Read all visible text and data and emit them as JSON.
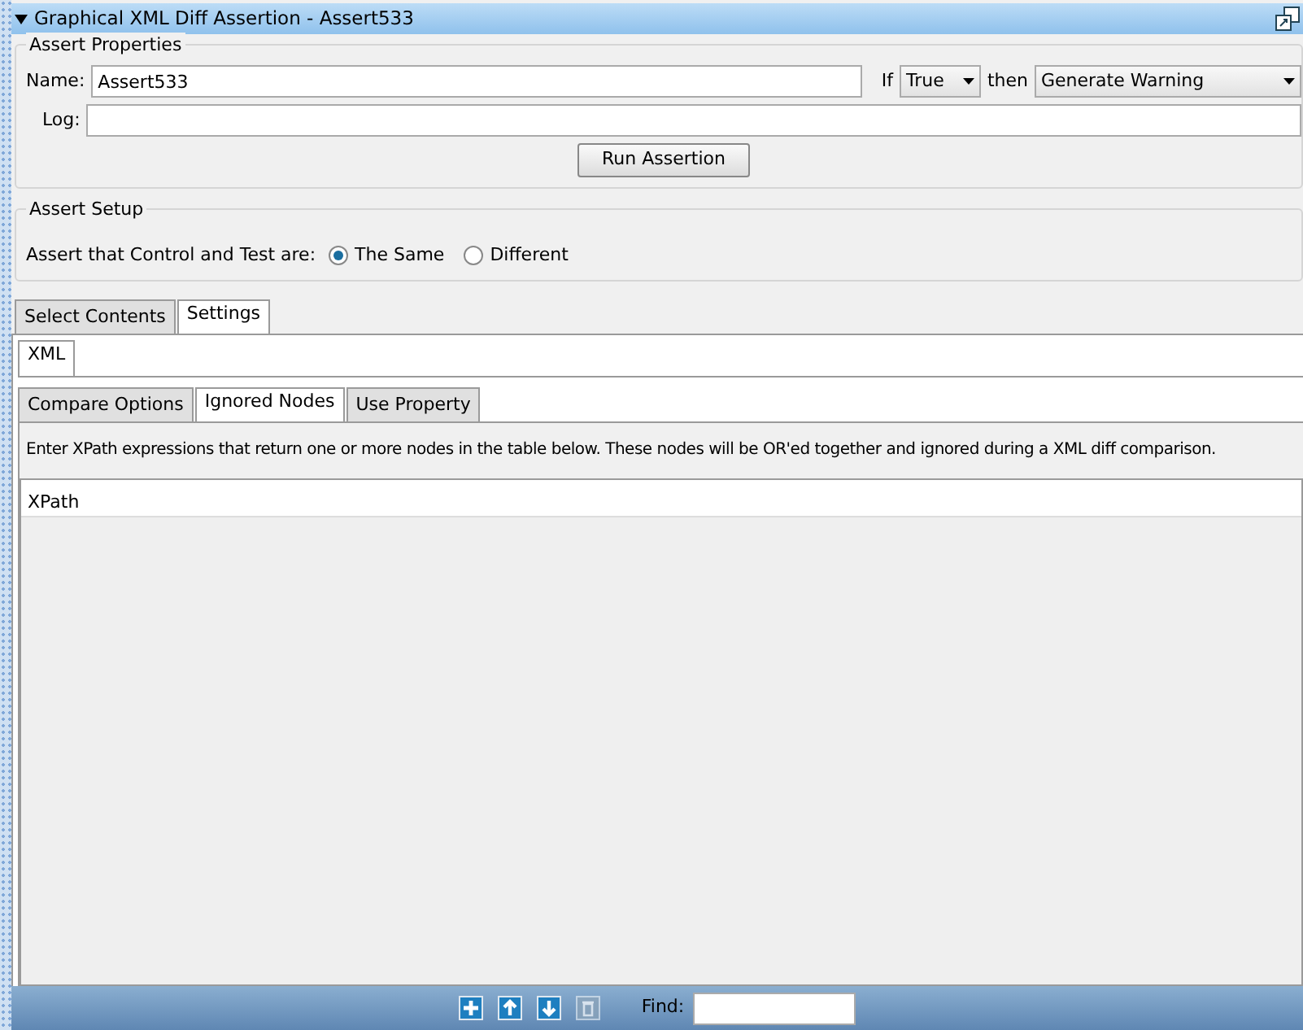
{
  "window": {
    "title": "Graphical XML Diff Assertion - Assert533",
    "expanded": true
  },
  "assert_properties": {
    "legend": "Assert Properties",
    "name_label": "Name:",
    "name_value": "Assert533",
    "if_label": "If",
    "condition": "True",
    "then_label": "then",
    "action": "Generate Warning",
    "log_label": "Log:",
    "run_button": "Run Assertion"
  },
  "assert_setup": {
    "legend": "Assert Setup",
    "prompt": "Assert that Control and Test are:",
    "options": [
      {
        "label": "The Same",
        "selected": true
      },
      {
        "label": "Different",
        "selected": false
      }
    ]
  },
  "tabs": [
    {
      "label": "Select Contents",
      "selected": false
    },
    {
      "label": "Settings",
      "selected": true
    }
  ],
  "sub_tabs": [
    {
      "label": "XML",
      "selected": true
    }
  ],
  "inner_tabs": [
    {
      "label": "Compare Options",
      "selected": false
    },
    {
      "label": "Ignored Nodes",
      "selected": true
    },
    {
      "label": "Use Property",
      "selected": false
    }
  ],
  "description": "Enter XPath expressions that return one or more nodes in the table below. These nodes will be OR'ed together and ignored during a XML diff comparison.",
  "table": {
    "columns": [
      "XPath"
    ]
  },
  "toolbar": {
    "buttons": [
      {
        "kind": "add",
        "disabled": false
      },
      {
        "kind": "up",
        "disabled": false
      },
      {
        "kind": "down",
        "disabled": false
      },
      {
        "kind": "delete",
        "disabled": true
      }
    ],
    "find_label": "Find:"
  }
}
